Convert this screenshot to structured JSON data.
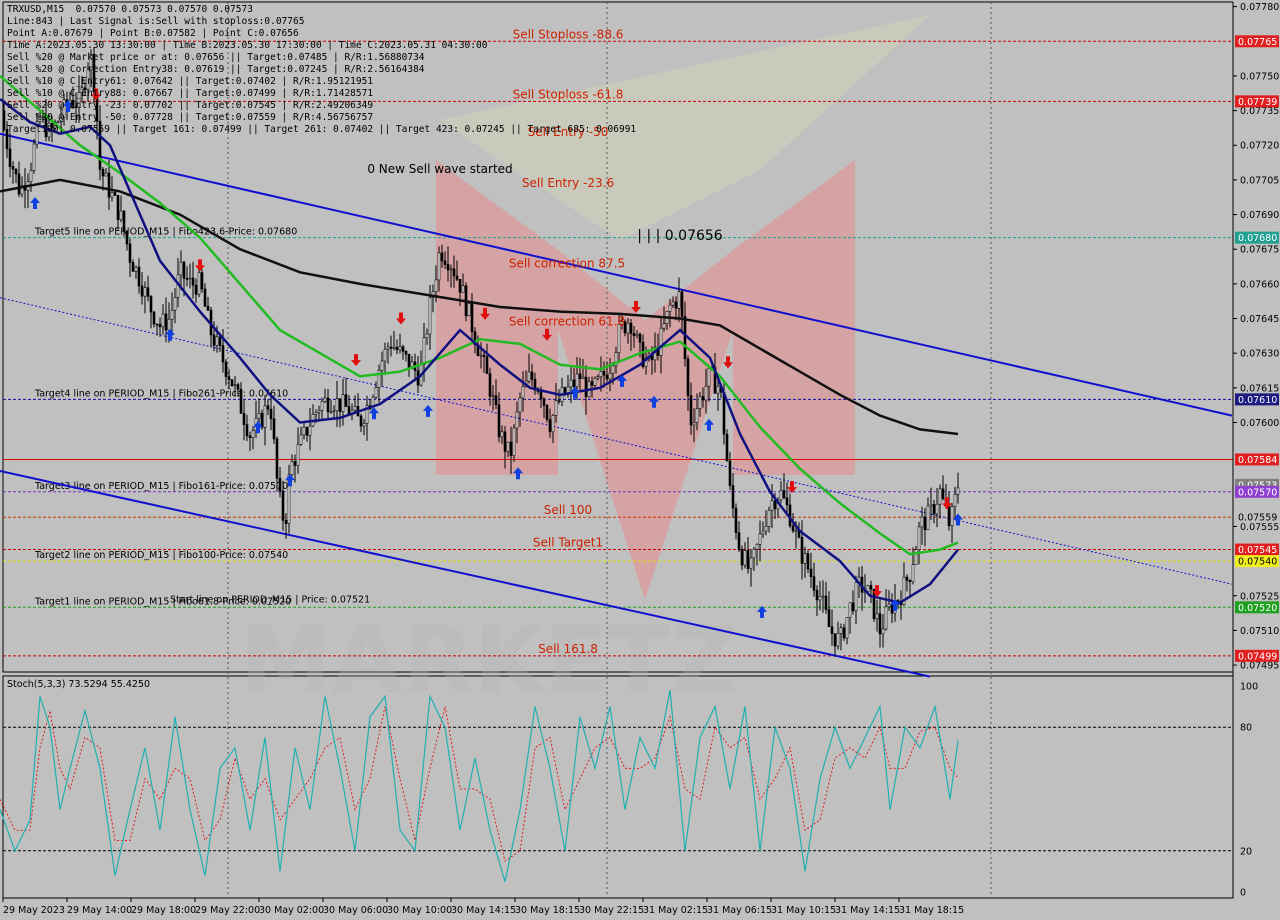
{
  "header": {
    "lines": [
      "TRXUSD,M15  0.07570 0.07573 0.07570 0.07573",
      "Line:843 | Last Signal is:Sell with stoploss:0.07765",
      "Point A:0.07679 | Point B:0.07582 | Point C:0.07656",
      "Time A:2023.05.30 13:30:00 | Time B:2023.05.30 17:30:00 | Time C:2023.05.31 04:30:00",
      "Sell %20 @ Market price or at: 0.07656 || Target:0.07485 | R/R:1.56880734",
      "Sell %20 @ Correction Entry38: 0.07619 || Target:0.07245 | R/R:2.56164384",
      "Sell %10 @ C_Entry61: 0.07642 || Target:0.07402 | R/R:1.95121951",
      "Sell %10 @ C_Entry88: 0.07667 || Target:0.07499 | R/R:1.71428571",
      "Sell %20 @ Entry -23: 0.07702 || Target:0.07545 | R/R:2.49206349",
      "Sell %20 @ Entry -50: 0.07728 || Target:0.07559 | R/R:4.56756757",
      "Target100: 0.07559 || Target 161: 0.07499 || Target 261: 0.07402 || Target 423: 0.07245 || Target 685: 0.06991"
    ]
  },
  "price_axis": {
    "ticks": [
      "0.07780",
      "0.07765",
      "0.07750",
      "0.07739",
      "0.07735",
      "0.07720",
      "0.07705",
      "0.07690",
      "0.07680",
      "0.07675",
      "0.07660",
      "0.07645",
      "0.07630",
      "0.07615",
      "0.07610",
      "0.07600",
      "0.07584",
      "0.07573",
      "0.07570",
      "0.07559",
      "0.07555",
      "0.07545",
      "0.07540",
      "0.07525",
      "0.07520",
      "0.07510",
      "0.07499",
      "0.07495"
    ]
  },
  "levels": [
    {
      "price": 0.07765,
      "label": "Sell Stoploss -88.6",
      "label_color": "#cc2200",
      "color": "#cc0000",
      "style": "dash",
      "tag": "0.07765",
      "tag_color": "#e02020"
    },
    {
      "price": 0.07739,
      "label": "Sell Stoploss -61.8",
      "label_color": "#cc2200",
      "color": "#cc0000",
      "style": "dash",
      "tag": "0.07739",
      "tag_color": "#e02020"
    },
    {
      "price": 0.0768,
      "label": "Target5 line on PERIOD_M15 | Fibo423.6-Price: 0.07680",
      "label_color": "#000000",
      "color": "#20a090",
      "style": "dash",
      "tag": "0.07680",
      "tag_color": "#20a090"
    },
    {
      "price": 0.0761,
      "label": "Target4 line on PERIOD_M15 | Fibo261-Price: 0.07610",
      "label_color": "#000000",
      "color": "#1010a0",
      "style": "dash",
      "tag": "0.07610",
      "tag_color": "#1a1a80"
    },
    {
      "price": 0.07584,
      "label": "",
      "label_color": "#000000",
      "color": "#e00000",
      "style": "solid",
      "tag": "0.07584",
      "tag_color": "#e02020"
    },
    {
      "price": 0.07573,
      "label": "",
      "label_color": "#000000",
      "color": "#c0c0c0",
      "style": "none",
      "tag": "0.07573",
      "tag_color": "#808080"
    },
    {
      "price": 0.0757,
      "label": "Target3 line on PERIOD_M15 | Fibo161-Price: 0.07570",
      "label_color": "#000000",
      "color": "#7030c0",
      "style": "dash",
      "tag": "0.07570",
      "tag_color": "#9040d0"
    },
    {
      "price": 0.07559,
      "label": "Sell 100",
      "label_color": "#cc2200",
      "color": "#cc3300",
      "style": "dash",
      "tag": "0.07559",
      "tag_color": "#c0c0c0"
    },
    {
      "price": 0.07545,
      "label": "Sell Target1",
      "label_color": "#cc2200",
      "color": "#cc0000",
      "style": "dash",
      "tag": "0.07545",
      "tag_color": "#e02020"
    },
    {
      "price": 0.0754,
      "label": "Target2 line on PERIOD_M15 | Fibo100-Price: 0.07540",
      "label_color": "#000000",
      "color": "#e0e000",
      "style": "dash",
      "tag": "0.07540",
      "tag_color": "#f0f020"
    },
    {
      "price": 0.0752,
      "label": "Target1 line on PERIOD_M15 | Fibo61.8-Price: 0.07520",
      "label_color": "#000000",
      "color": "#20a020",
      "style": "dash",
      "tag": "0.07520",
      "tag_color": "#20a020"
    },
    {
      "price": 0.07499,
      "label": "Sell 161.8",
      "label_color": "#cc2200",
      "color": "#cc0000",
      "style": "dash",
      "tag": "0.07499",
      "tag_color": "#e02020"
    }
  ],
  "annotations": [
    {
      "text": "Sell Entry -50",
      "price": 0.07724,
      "x": 568,
      "color": "#cc2200"
    },
    {
      "text": "Sell Entry -23.6",
      "price": 0.07702,
      "x": 568,
      "color": "#cc2200"
    },
    {
      "text": "0 New Sell wave started",
      "price": 0.07708,
      "x": 440,
      "color": "#000000"
    },
    {
      "text": "| | | 0.07656",
      "price": 0.07679,
      "x": 680,
      "color": "#000000",
      "big": true
    },
    {
      "text": "Sell correction 87.5",
      "price": 0.07667,
      "x": 567,
      "color": "#cc2200"
    },
    {
      "text": "Sell correction 61.8",
      "price": 0.07642,
      "x": 567,
      "color": "#cc2200"
    },
    {
      "text": "Start line on PERIOD_M15 | Price: 0.07521",
      "price": 0.07522,
      "x": 170,
      "color": "#000000"
    }
  ],
  "stoch": {
    "label": "Stoch(5,3,3) 73.5294 55.4250",
    "ticks": [
      "100",
      "80",
      "20",
      "0"
    ]
  },
  "x_axis": {
    "labels": [
      "29 May 2023",
      "29 May 14:00",
      "29 May 18:00",
      "29 May 22:00",
      "30 May 02:00",
      "30 May 06:00",
      "30 May 10:00",
      "30 May 14:15",
      "30 May 18:15",
      "30 May 22:15",
      "31 May 02:15",
      "31 May 06:15",
      "31 May 10:15",
      "31 May 14:15",
      "31 May 18:15"
    ]
  },
  "chart_data": {
    "type": "candlestick",
    "symbol": "TRXUSD",
    "timeframe": "M15",
    "ohlc_last": {
      "open": 0.0757,
      "high": 0.07573,
      "low": 0.0757,
      "close": 0.07573
    },
    "ylim": [
      0.07492,
      0.07782
    ],
    "close_path": [
      [
        0,
        0.07735
      ],
      [
        10,
        0.07715
      ],
      [
        20,
        0.077
      ],
      [
        30,
        0.0771
      ],
      [
        40,
        0.07732
      ],
      [
        50,
        0.07725
      ],
      [
        60,
        0.07732
      ],
      [
        70,
        0.0774
      ],
      [
        80,
        0.07738
      ],
      [
        90,
        0.0776
      ],
      [
        95,
        0.07745
      ],
      [
        100,
        0.0771
      ],
      [
        110,
        0.077
      ],
      [
        120,
        0.0769
      ],
      [
        130,
        0.07672
      ],
      [
        140,
        0.07662
      ],
      [
        150,
        0.0765
      ],
      [
        160,
        0.07642
      ],
      [
        170,
        0.07645
      ],
      [
        180,
        0.07665
      ],
      [
        190,
        0.0766
      ],
      [
        200,
        0.0766
      ],
      [
        210,
        0.0764
      ],
      [
        220,
        0.0763
      ],
      [
        230,
        0.0762
      ],
      [
        240,
        0.07608
      ],
      [
        250,
        0.07595
      ],
      [
        260,
        0.076
      ],
      [
        270,
        0.0761
      ],
      [
        278,
        0.0757
      ],
      [
        285,
        0.07555
      ],
      [
        290,
        0.0758
      ],
      [
        300,
        0.0759
      ],
      [
        310,
        0.076
      ],
      [
        320,
        0.07608
      ],
      [
        330,
        0.0761
      ],
      [
        340,
        0.07608
      ],
      [
        350,
        0.07605
      ],
      [
        360,
        0.076
      ],
      [
        370,
        0.0761
      ],
      [
        380,
        0.07625
      ],
      [
        390,
        0.07635
      ],
      [
        400,
        0.0763
      ],
      [
        410,
        0.07625
      ],
      [
        420,
        0.0762
      ],
      [
        430,
        0.0765
      ],
      [
        440,
        0.07675
      ],
      [
        450,
        0.0767
      ],
      [
        460,
        0.0766
      ],
      [
        470,
        0.07645
      ],
      [
        480,
        0.0763
      ],
      [
        490,
        0.07615
      ],
      [
        500,
        0.07595
      ],
      [
        510,
        0.07585
      ],
      [
        520,
        0.0761
      ],
      [
        530,
        0.0762
      ],
      [
        540,
        0.07615
      ],
      [
        550,
        0.076
      ],
      [
        560,
        0.0761
      ],
      [
        570,
        0.07615
      ],
      [
        580,
        0.0762
      ],
      [
        590,
        0.07612
      ],
      [
        600,
        0.07618
      ],
      [
        610,
        0.07625
      ],
      [
        620,
        0.0764
      ],
      [
        630,
        0.07645
      ],
      [
        640,
        0.0763
      ],
      [
        650,
        0.07625
      ],
      [
        660,
        0.07635
      ],
      [
        670,
        0.0765
      ],
      [
        680,
        0.07655
      ],
      [
        690,
        0.076
      ],
      [
        700,
        0.0761
      ],
      [
        710,
        0.0762
      ],
      [
        720,
        0.07615
      ],
      [
        730,
        0.0757
      ],
      [
        740,
        0.07545
      ],
      [
        750,
        0.07535
      ],
      [
        760,
        0.0755
      ],
      [
        770,
        0.07565
      ],
      [
        780,
        0.0757
      ],
      [
        790,
        0.0756
      ],
      [
        800,
        0.07545
      ],
      [
        810,
        0.07535
      ],
      [
        820,
        0.07525
      ],
      [
        830,
        0.0751
      ],
      [
        840,
        0.07505
      ],
      [
        850,
        0.0752
      ],
      [
        860,
        0.0753
      ],
      [
        870,
        0.07525
      ],
      [
        880,
        0.0751
      ],
      [
        890,
        0.0752
      ],
      [
        900,
        0.07525
      ],
      [
        910,
        0.07535
      ],
      [
        920,
        0.07555
      ],
      [
        930,
        0.0756
      ],
      [
        940,
        0.0757
      ],
      [
        950,
        0.07555
      ],
      [
        958,
        0.07573
      ]
    ],
    "ma_black": [
      [
        0,
        0.077
      ],
      [
        60,
        0.07705
      ],
      [
        120,
        0.077
      ],
      [
        180,
        0.0769
      ],
      [
        240,
        0.07675
      ],
      [
        300,
        0.07665
      ],
      [
        360,
        0.0766
      ],
      [
        430,
        0.07655
      ],
      [
        500,
        0.0765
      ],
      [
        560,
        0.07648
      ],
      [
        620,
        0.07647
      ],
      [
        680,
        0.07645
      ],
      [
        720,
        0.07642
      ],
      [
        760,
        0.07632
      ],
      [
        800,
        0.07622
      ],
      [
        840,
        0.07612
      ],
      [
        880,
        0.07603
      ],
      [
        920,
        0.07597
      ],
      [
        958,
        0.07595
      ]
    ],
    "ma_green": [
      [
        0,
        0.0775
      ],
      [
        40,
        0.07735
      ],
      [
        80,
        0.0772
      ],
      [
        120,
        0.07708
      ],
      [
        160,
        0.07695
      ],
      [
        200,
        0.0768
      ],
      [
        240,
        0.0766
      ],
      [
        280,
        0.0764
      ],
      [
        320,
        0.0763
      ],
      [
        360,
        0.0762
      ],
      [
        400,
        0.07622
      ],
      [
        440,
        0.07628
      ],
      [
        480,
        0.07636
      ],
      [
        520,
        0.07634
      ],
      [
        560,
        0.07625
      ],
      [
        600,
        0.07623
      ],
      [
        640,
        0.0763
      ],
      [
        680,
        0.07635
      ],
      [
        720,
        0.0762
      ],
      [
        760,
        0.07598
      ],
      [
        800,
        0.0758
      ],
      [
        840,
        0.07565
      ],
      [
        880,
        0.07552
      ],
      [
        910,
        0.07543
      ],
      [
        940,
        0.07545
      ],
      [
        958,
        0.07548
      ]
    ],
    "ma_navy": [
      [
        0,
        0.0774
      ],
      [
        30,
        0.0773
      ],
      [
        60,
        0.07725
      ],
      [
        90,
        0.07728
      ],
      [
        110,
        0.0772
      ],
      [
        130,
        0.077
      ],
      [
        160,
        0.0767
      ],
      [
        200,
        0.07648
      ],
      [
        240,
        0.07628
      ],
      [
        270,
        0.07612
      ],
      [
        300,
        0.076
      ],
      [
        340,
        0.07602
      ],
      [
        380,
        0.07608
      ],
      [
        420,
        0.0762
      ],
      [
        460,
        0.0764
      ],
      [
        500,
        0.07625
      ],
      [
        530,
        0.07615
      ],
      [
        560,
        0.07612
      ],
      [
        600,
        0.07615
      ],
      [
        640,
        0.07625
      ],
      [
        680,
        0.0764
      ],
      [
        710,
        0.07628
      ],
      [
        740,
        0.07595
      ],
      [
        770,
        0.0757
      ],
      [
        800,
        0.07553
      ],
      [
        840,
        0.0754
      ],
      [
        870,
        0.07525
      ],
      [
        900,
        0.07522
      ],
      [
        930,
        0.0753
      ],
      [
        958,
        0.07545
      ]
    ],
    "channel_upper": [
      [
        0,
        0.07725
      ],
      [
        1232,
        0.07603
      ]
    ],
    "channel_lower": [
      [
        0,
        0.07579
      ],
      [
        930,
        0.0749
      ]
    ],
    "channel_mid_dotted": [
      [
        0,
        0.07654
      ],
      [
        1232,
        0.0753
      ]
    ],
    "stoch_k": [
      [
        0,
        40
      ],
      [
        15,
        20
      ],
      [
        30,
        35
      ],
      [
        40,
        95
      ],
      [
        50,
        80
      ],
      [
        60,
        40
      ],
      [
        70,
        60
      ],
      [
        85,
        88
      ],
      [
        100,
        60
      ],
      [
        115,
        8
      ],
      [
        130,
        40
      ],
      [
        145,
        70
      ],
      [
        160,
        30
      ],
      [
        175,
        85
      ],
      [
        190,
        40
      ],
      [
        205,
        8
      ],
      [
        220,
        60
      ],
      [
        235,
        70
      ],
      [
        250,
        30
      ],
      [
        265,
        75
      ],
      [
        280,
        10
      ],
      [
        295,
        70
      ],
      [
        310,
        40
      ],
      [
        325,
        95
      ],
      [
        340,
        60
      ],
      [
        355,
        20
      ],
      [
        370,
        85
      ],
      [
        385,
        95
      ],
      [
        400,
        30
      ],
      [
        415,
        20
      ],
      [
        430,
        95
      ],
      [
        445,
        80
      ],
      [
        460,
        30
      ],
      [
        475,
        65
      ],
      [
        490,
        30
      ],
      [
        505,
        5
      ],
      [
        520,
        40
      ],
      [
        535,
        90
      ],
      [
        550,
        60
      ],
      [
        565,
        20
      ],
      [
        580,
        85
      ],
      [
        595,
        60
      ],
      [
        610,
        90
      ],
      [
        625,
        40
      ],
      [
        640,
        75
      ],
      [
        655,
        60
      ],
      [
        670,
        98
      ],
      [
        685,
        20
      ],
      [
        700,
        75
      ],
      [
        715,
        90
      ],
      [
        730,
        50
      ],
      [
        745,
        90
      ],
      [
        760,
        20
      ],
      [
        775,
        80
      ],
      [
        790,
        60
      ],
      [
        805,
        10
      ],
      [
        820,
        55
      ],
      [
        835,
        80
      ],
      [
        850,
        60
      ],
      [
        865,
        75
      ],
      [
        880,
        90
      ],
      [
        890,
        40
      ],
      [
        905,
        80
      ],
      [
        920,
        70
      ],
      [
        935,
        90
      ],
      [
        950,
        45
      ],
      [
        958,
        73.5
      ]
    ],
    "stoch_d": [
      [
        0,
        45
      ],
      [
        15,
        30
      ],
      [
        30,
        30
      ],
      [
        40,
        70
      ],
      [
        50,
        88
      ],
      [
        60,
        60
      ],
      [
        70,
        50
      ],
      [
        85,
        75
      ],
      [
        100,
        70
      ],
      [
        115,
        25
      ],
      [
        130,
        25
      ],
      [
        145,
        55
      ],
      [
        160,
        45
      ],
      [
        175,
        60
      ],
      [
        190,
        55
      ],
      [
        205,
        25
      ],
      [
        220,
        35
      ],
      [
        235,
        65
      ],
      [
        250,
        45
      ],
      [
        265,
        55
      ],
      [
        280,
        35
      ],
      [
        295,
        45
      ],
      [
        310,
        55
      ],
      [
        325,
        70
      ],
      [
        340,
        75
      ],
      [
        355,
        40
      ],
      [
        370,
        55
      ],
      [
        385,
        90
      ],
      [
        400,
        55
      ],
      [
        415,
        25
      ],
      [
        430,
        60
      ],
      [
        445,
        90
      ],
      [
        460,
        50
      ],
      [
        475,
        50
      ],
      [
        490,
        45
      ],
      [
        505,
        15
      ],
      [
        520,
        20
      ],
      [
        535,
        70
      ],
      [
        550,
        75
      ],
      [
        565,
        40
      ],
      [
        580,
        55
      ],
      [
        595,
        70
      ],
      [
        610,
        75
      ],
      [
        625,
        60
      ],
      [
        640,
        60
      ],
      [
        655,
        65
      ],
      [
        670,
        85
      ],
      [
        685,
        50
      ],
      [
        700,
        45
      ],
      [
        715,
        80
      ],
      [
        730,
        70
      ],
      [
        745,
        75
      ],
      [
        760,
        45
      ],
      [
        775,
        55
      ],
      [
        790,
        70
      ],
      [
        805,
        30
      ],
      [
        820,
        35
      ],
      [
        835,
        65
      ],
      [
        850,
        70
      ],
      [
        865,
        65
      ],
      [
        880,
        80
      ],
      [
        890,
        60
      ],
      [
        905,
        60
      ],
      [
        920,
        78
      ],
      [
        935,
        80
      ],
      [
        950,
        60
      ],
      [
        958,
        55.4
      ]
    ]
  }
}
